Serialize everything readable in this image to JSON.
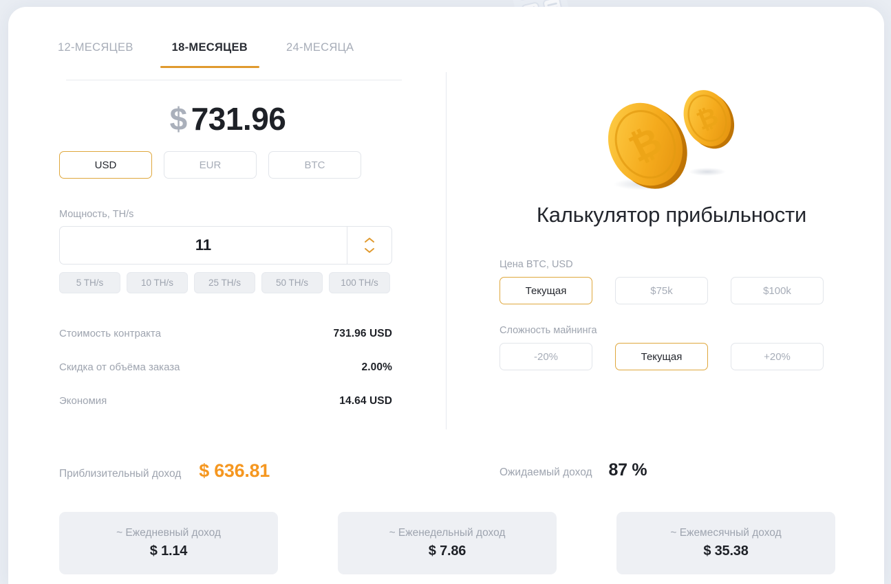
{
  "tabs": [
    {
      "label": "12-МЕСЯЦЕВ",
      "active": false
    },
    {
      "label": "18-МЕСЯЦЕВ",
      "active": true
    },
    {
      "label": "24-МЕСЯЦА",
      "active": false
    }
  ],
  "left": {
    "price": {
      "symbol": "$",
      "amount": "731.96"
    },
    "currencies": [
      {
        "label": "USD",
        "selected": true
      },
      {
        "label": "EUR",
        "selected": false
      },
      {
        "label": "BTC",
        "selected": false
      }
    ],
    "power": {
      "label": "Мощность, TH/s",
      "value": "11",
      "presets": [
        "5 TH/s",
        "10 TH/s",
        "25 TH/s",
        "50 TH/s",
        "100 TH/s"
      ]
    },
    "summary": [
      {
        "label": "Стоимость контракта",
        "value": "731.96 USD"
      },
      {
        "label": "Скидка от объёма заказа",
        "value": "2.00%"
      },
      {
        "label": "Экономия",
        "value": "14.64 USD"
      }
    ]
  },
  "right": {
    "title": "Калькулятор прибыльности",
    "btc_price": {
      "label": "Цена BTC, USD",
      "options": [
        {
          "label": "Текущая",
          "selected": true
        },
        {
          "label": "$75k",
          "selected": false
        },
        {
          "label": "$100k",
          "selected": false
        }
      ]
    },
    "difficulty": {
      "label": "Сложность майнинга",
      "options": [
        {
          "label": "-20%",
          "selected": false
        },
        {
          "label": "Текущая",
          "selected": true
        },
        {
          "label": "+20%",
          "selected": false
        }
      ]
    }
  },
  "income": {
    "approx_label": "Приблизительный доход",
    "approx_value": "$ 636.81",
    "expected_label": "Ожидаемый доход",
    "expected_value": "87 %"
  },
  "period_cards": [
    {
      "title": "~ Ежедневный доход",
      "value": "$ 1.14"
    },
    {
      "title": "~ Еженедельный доход",
      "value": "$ 7.86"
    },
    {
      "title": "~ Ежемесячный доход",
      "value": "$ 35.38"
    }
  ],
  "colors": {
    "accent": "#e09a2e",
    "accent_strong": "#f59720",
    "border_selected": "#dfa73c",
    "page_bg": "#e9edf3",
    "card_bg": "#ffffff",
    "muted_text": "#9ea4af",
    "dark_text": "#1e2127",
    "chip_bg": "#eef0f4"
  },
  "icons": {
    "calculator_watermark": "calculator-icon",
    "coins": "bitcoin-coins-illustration",
    "stepper_up": "chevron-up-icon",
    "stepper_down": "chevron-down-icon"
  }
}
